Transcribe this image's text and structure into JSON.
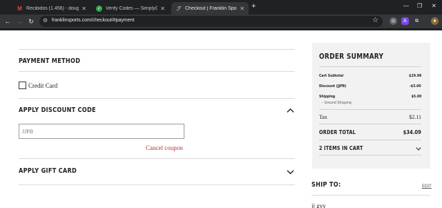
{
  "browser": {
    "tabs": [
      {
        "title": "Recibidos (1.456) - douglasqui",
        "icon": "gmail-icon",
        "active": false
      },
      {
        "title": "Verify Codes — SimplyCodes",
        "icon": "simplycodes-icon",
        "active": false
      },
      {
        "title": "Checkout | Franklin Sports",
        "icon": "franklin-icon",
        "active": true
      }
    ],
    "url": "franklinsports.com/checkout/#payment"
  },
  "payment": {
    "title": "PAYMENT METHOD",
    "option_label": "Credit Card",
    "option_checked": false
  },
  "discount": {
    "title": "APPLY DISCOUNT CODE",
    "expanded": true,
    "input_placeholder": "JJPB",
    "cancel_label": "Cancel coupon"
  },
  "gift_card": {
    "title": "APPLY GIFT CARD",
    "expanded": false
  },
  "order_summary": {
    "title": "ORDER SUMMARY",
    "subtotal_label": "Cart Subtotal",
    "subtotal_value": "$29.98",
    "discount_label": "Discount (JJPB)",
    "discount_value": "-$3.00",
    "shipping_label": "Shipping",
    "shipping_value": "$5.00",
    "shipping_method": "– Ground Shipping",
    "tax_label": "Tax",
    "tax_value": "$2.11",
    "total_label": "ORDER TOTAL",
    "total_value": "$34.09",
    "items_label": "2 ITEMS IN CART"
  },
  "ship_to": {
    "title": "SHIP TO:",
    "edit_label": "EDIT",
    "name": "jj gyy"
  }
}
